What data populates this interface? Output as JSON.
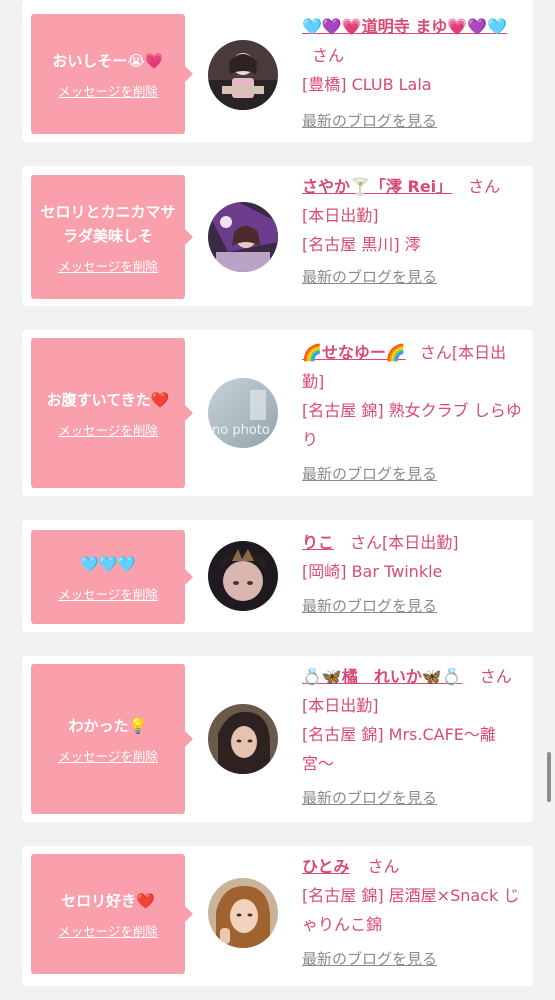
{
  "messages": [
    {
      "text": "おいしそー😭💗",
      "delete_label": "メッセージを削除",
      "name": "🩵💜💗道明寺 まゆ💗💜🩵",
      "honorific": "さん",
      "lines": [
        "[豊橋] CLUB Lala"
      ],
      "blog_label": "最新のブログを見る"
    },
    {
      "text": "セロリとカニカマサラダ美味しそ",
      "delete_label": "メッセージを削除",
      "name": "さやか🍸「澪 Rei」",
      "honorific": "さん",
      "lines": [
        "[本日出勤]",
        "[名古屋 黒川] 澪"
      ],
      "blog_label": "最新のブログを見る"
    },
    {
      "text": "お腹すいてきた❤️",
      "delete_label": "メッセージを削除",
      "name": "🌈せなゆー🌈",
      "honorific": "さん",
      "status": "[本日出勤]",
      "lines": [
        "[名古屋 錦] 熟女クラブ しらゆり"
      ],
      "blog_label": "最新のブログを見る",
      "avatar_text": "no photo"
    },
    {
      "text": "🩵🩵🩵",
      "delete_label": "メッセージを削除",
      "name": "りこ",
      "honorific": "さん",
      "status": "[本日出勤]",
      "lines": [
        "[岡崎] Bar Twinkle"
      ],
      "blog_label": "最新のブログを見る"
    },
    {
      "text": "わかった💡",
      "delete_label": "メッセージを削除",
      "name": "💍🦋橘　れいか🦋💍",
      "honorific": "さん",
      "status": "[本日出勤]",
      "lines": [
        "[名古屋 錦] Mrs.CAFE〜離宮〜"
      ],
      "blog_label": "最新のブログを見る"
    },
    {
      "text": "セロリ好き❤️",
      "delete_label": "メッセージを削除",
      "name": "ひとみ",
      "honorific": "さん",
      "lines": [
        "[名古屋 錦] 居酒屋×Snack じゃりんこ錦"
      ],
      "blog_label": "最新のブログを見る"
    }
  ],
  "colors": {
    "bubble": "#f9a0ac",
    "accent": "#d94a72",
    "link_gray": "#8a8a8a"
  }
}
